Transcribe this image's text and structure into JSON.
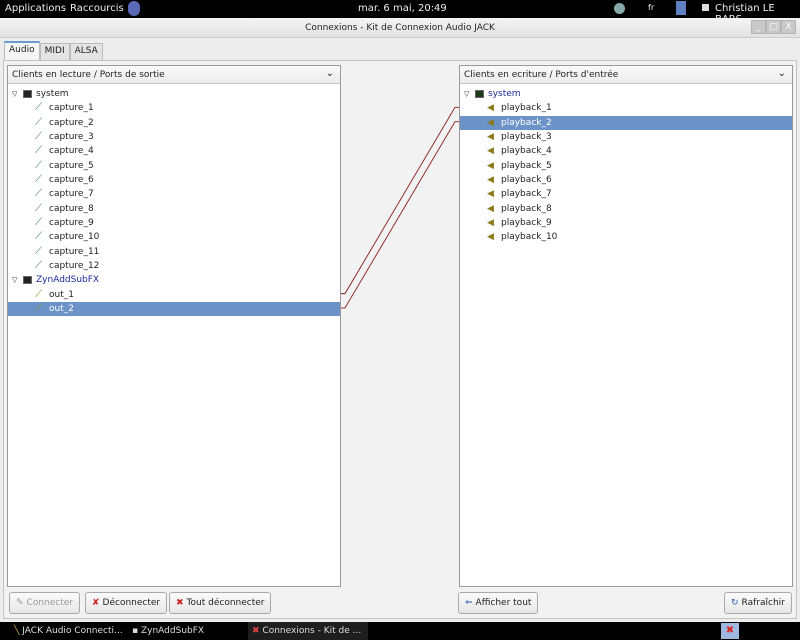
{
  "top_panel": {
    "applications": "Applications",
    "shortcuts": "Raccourcis",
    "clock": "mar.  6 mai, 20:49",
    "keyboard": "fr",
    "user": "Christian LE BARS"
  },
  "window": {
    "title": "Connexions - Kit de Connexion Audio JACK",
    "minimize": "_",
    "maximize": "□",
    "close": "X"
  },
  "tabs": [
    {
      "label": "Audio",
      "active": true
    },
    {
      "label": "MIDI"
    },
    {
      "label": "ALSA"
    }
  ],
  "left_panel": {
    "header": "Clients en lecture / Ports de sortie",
    "rows": [
      {
        "type": "client",
        "label": "system"
      },
      {
        "label": "capture_1"
      },
      {
        "label": "capture_2"
      },
      {
        "label": "capture_3"
      },
      {
        "label": "capture_4"
      },
      {
        "label": "capture_5"
      },
      {
        "label": "capture_6"
      },
      {
        "label": "capture_7"
      },
      {
        "label": "capture_8"
      },
      {
        "label": "capture_9"
      },
      {
        "label": "capture_10"
      },
      {
        "label": "capture_11"
      },
      {
        "label": "capture_12"
      },
      {
        "type": "client",
        "label": "ZynAddSubFX",
        "connected": true
      },
      {
        "label": "out_1",
        "connected": true
      },
      {
        "label": "out_2",
        "connected": true,
        "selected": true
      }
    ]
  },
  "right_panel": {
    "header": "Clients en ecriture / Ports d'entrée",
    "rows": [
      {
        "type": "client",
        "label": "system",
        "connected": true
      },
      {
        "label": "playback_1",
        "connected": true
      },
      {
        "label": "playback_2",
        "connected": true,
        "selected": true
      },
      {
        "label": "playback_3"
      },
      {
        "label": "playback_4"
      },
      {
        "label": "playback_5"
      },
      {
        "label": "playback_6"
      },
      {
        "label": "playback_7"
      },
      {
        "label": "playback_8"
      },
      {
        "label": "playback_9"
      },
      {
        "label": "playback_10"
      }
    ]
  },
  "connections": [
    [
      "out_1",
      "playback_1"
    ],
    [
      "out_2",
      "playback_2"
    ]
  ],
  "buttons": {
    "connect": "Connecter",
    "disconnect": "Déconnecter",
    "disconnect_all": "Tout déconnecter",
    "show_all": "Afficher tout",
    "refresh": "Rafraîchir"
  },
  "taskbar": {
    "items": [
      "JACK Audio Connecti...",
      "ZynAddSubFX",
      "Connexions - Kit de ..."
    ]
  }
}
